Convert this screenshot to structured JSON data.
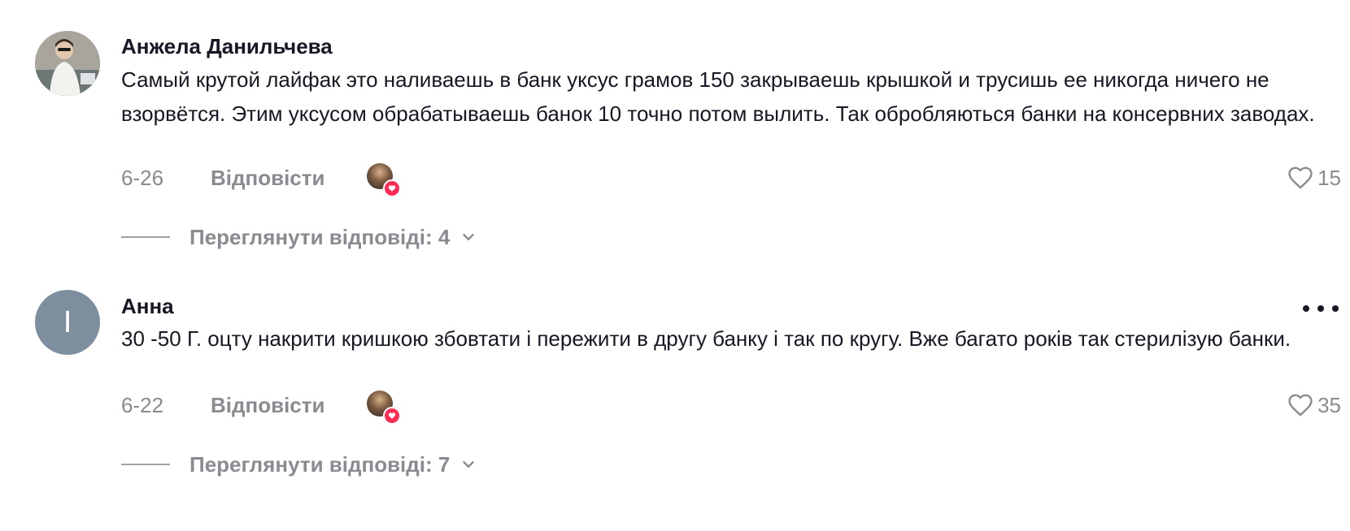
{
  "comments": [
    {
      "username": "Анжела Данильчева",
      "text": "Самый крутой лайфак это наливаешь в банк уксус грамов 150 закрываешь крышкой и трусишь ее никогда ничего не взорвётся. Этим уксусом обрабатываешь банок 10 точно потом вылить. Так обробляються банки на консервних заводах.",
      "date": "6-26",
      "reply_label": "Відповісти",
      "likes": "15",
      "view_replies": "Переглянути відповіді: 4"
    },
    {
      "username": "Анна",
      "avatar_letter": "I",
      "text": "30 -50 Г. оцту накрити кришкою збовтати і пережити в другу банку і так по кругу. Вже багато років так стерилізую банки.",
      "date": "6-22",
      "reply_label": "Відповісти",
      "likes": "35",
      "view_replies": "Переглянути відповіді: 7"
    }
  ],
  "colors": {
    "text": "#161823",
    "secondary": "#8a8b91",
    "heart_badge": "#fe2c55",
    "letter_avatar": "#7d8f9e"
  },
  "icons": [
    "heart-outline-icon",
    "chevron-down-icon",
    "more-dots-icon",
    "creator-heart-badge-icon"
  ]
}
